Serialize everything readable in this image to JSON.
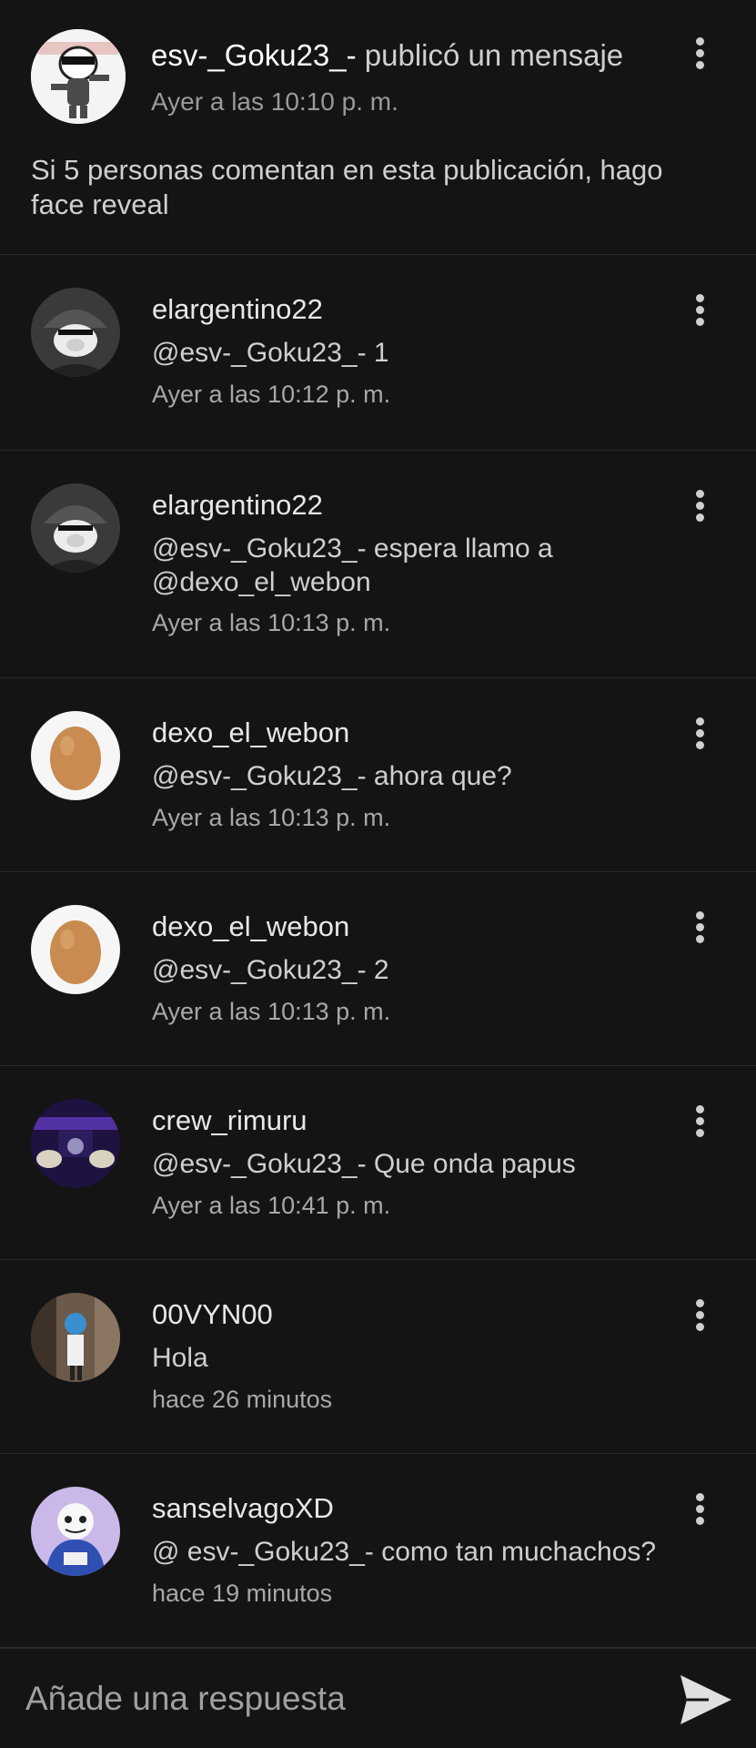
{
  "post": {
    "author": "esv-_Goku23_-",
    "action": " publicó un mensaje",
    "time": "Ayer a las 10:10 p. m.",
    "body": "Si 5 personas comentan en esta publicación, hago face reveal",
    "menu_icon": "more-vert-icon"
  },
  "comments": [
    {
      "user": "elargentino22",
      "text": "@esv-_Goku23_- 1",
      "time": "Ayer a las 10:12 p. m.",
      "avatar": "helmet-pig-avatar"
    },
    {
      "user": "elargentino22",
      "text": "@esv-_Goku23_- espera llamo a @dexo_el_webon",
      "time": "Ayer a las 10:13 p. m.",
      "avatar": "helmet-pig-avatar"
    },
    {
      "user": "dexo_el_webon",
      "text": "@esv-_Goku23_- ahora que?",
      "time": "Ayer a las 10:13 p. m.",
      "avatar": "egg-avatar"
    },
    {
      "user": "dexo_el_webon",
      "text": "@esv-_Goku23_- 2",
      "time": "Ayer a las 10:13 p. m.",
      "avatar": "egg-avatar"
    },
    {
      "user": "crew_rimuru",
      "text": "@esv-_Goku23_-  Que onda papus",
      "time": "Ayer a las 10:41 p. m.",
      "avatar": "purple-stage-avatar"
    },
    {
      "user": "00VYN00",
      "text": "Hola",
      "time": "hace 26 minutos",
      "avatar": "character-avatar"
    },
    {
      "user": "sanselvagoXD",
      "text": "@ esv-_Goku23_-  como tan muchachos?",
      "time": "hace 19 minutos",
      "avatar": "skeleton-avatar"
    }
  ],
  "reply": {
    "placeholder": "Añade una respuesta",
    "send_icon": "send-icon"
  },
  "colors": {
    "background": "#141414",
    "divider": "#2a2a2a",
    "primary_text": "#e8e8e8",
    "secondary_text": "#a8a8a8"
  }
}
